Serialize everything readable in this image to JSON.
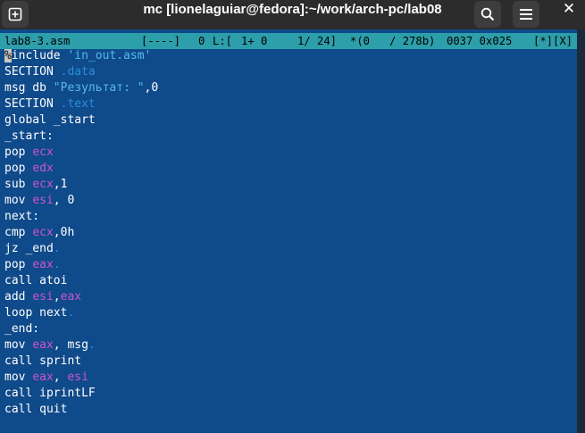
{
  "window": {
    "title": "mc [lionelaguiar@fedora]:~/work/arch-pc/lab08",
    "new_tab_icon": "new-tab-icon",
    "search_icon": "search-icon",
    "menu_icon": "hamburger-menu-icon",
    "close_icon": "close-icon",
    "close_glyph": "✕"
  },
  "status": {
    "filename": "lab8-3.asm",
    "flags": "[----]",
    "col": "0",
    "line_label": "L:[",
    "line_pos": "1+ 0",
    "line_total": "1/ 24]",
    "char_info": "*(0   / 278b)",
    "char_code": "0037 0x025",
    "buttons": "[*][X]"
  },
  "code": [
    "%include 'in_out.asm'",
    "SECTION .data",
    "msg db \"Результат: \",0",
    "SECTION .text",
    "global _start",
    "_start:",
    "pop ecx",
    "pop edx",
    "sub ecx,1",
    "mov esi, 0",
    "next:",
    "cmp ecx,0h",
    "jz _end.",
    "pop eax.",
    "call atoi",
    "add esi,eax",
    "loop next.",
    "_end:",
    "mov eax, msg.",
    "call sprint",
    "mov eax, esi",
    "call iprintLF",
    "call quit"
  ],
  "colors": {
    "editor_bg": "#114488",
    "status_bg": "#2d9faa",
    "register": "#cc55cc",
    "string": "#55bbee",
    "directive": "#2a8fd8"
  }
}
